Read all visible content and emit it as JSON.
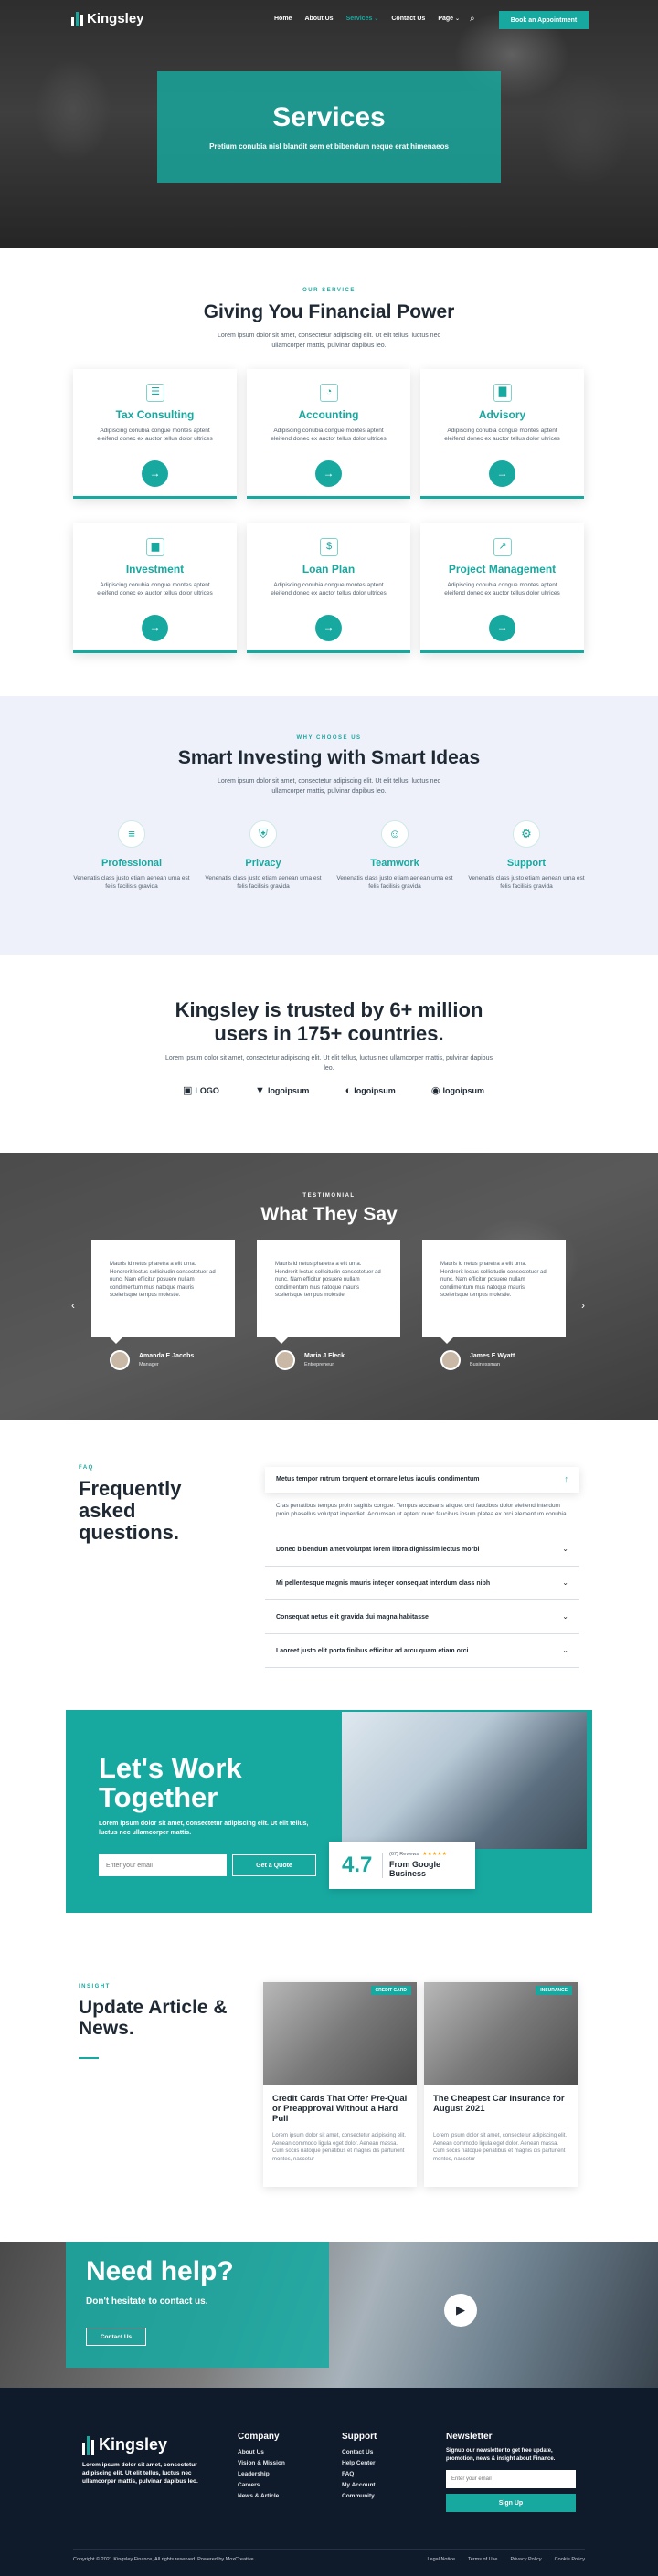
{
  "brand": {
    "name": "Kingsley",
    "accent": "#17a9a0",
    "dark": "#0f1a2b"
  },
  "nav": {
    "items": [
      "Home",
      "About Us",
      "Services",
      "Contact Us",
      "Page"
    ],
    "active": "Services",
    "search_icon": "search-icon",
    "cta": "Book an Appointment"
  },
  "hero": {
    "title": "Services",
    "subtitle": "Pretium conubia nisl blandit sem et bibendum neque erat himenaeos"
  },
  "services": {
    "eyebrow": "OUR SERVICE",
    "title": "Giving You Financial Power",
    "subtitle": "Lorem ipsum dolor sit amet, consectetur adipiscing elit. Ut elit tellus, luctus nec ullamcorper mattis, pulvinar dapibus leo.",
    "cards": [
      {
        "title": "Tax Consulting",
        "desc": "Adipiscing conubia congue montes aptent eleifend donec ex auctor tellus dolor ultrices",
        "icon": "document-icon"
      },
      {
        "title": "Accounting",
        "desc": "Adipiscing conubia congue montes aptent eleifend donec ex auctor tellus dolor ultrices",
        "icon": "pie-chart-icon"
      },
      {
        "title": "Advisory",
        "desc": "Adipiscing conubia congue montes aptent eleifend donec ex auctor tellus dolor ultrices",
        "icon": "bar-chart-icon"
      },
      {
        "title": "Investment",
        "desc": "Adipiscing conubia congue montes aptent eleifend donec ex auctor tellus dolor ultrices",
        "icon": "growth-chart-icon"
      },
      {
        "title": "Loan Plan",
        "desc": "Adipiscing conubia congue montes aptent eleifend donec ex auctor tellus dolor ultrices",
        "icon": "dollar-icon"
      },
      {
        "title": "Project Management",
        "desc": "Adipiscing conubia congue montes aptent eleifend donec ex auctor tellus dolor ultrices",
        "icon": "line-chart-icon"
      }
    ]
  },
  "why": {
    "eyebrow": "WHY CHOOSE US",
    "title": "Smart Investing with Smart Ideas",
    "subtitle": "Lorem ipsum dolor sit amet, consectetur adipiscing elit. Ut elit tellus, luctus nec ullamcorper mattis, pulvinar dapibus leo.",
    "items": [
      {
        "title": "Professional",
        "desc": "Venenatis class justo etiam aenean urna est felis facilisis gravida",
        "icon": "layers-icon"
      },
      {
        "title": "Privacy",
        "desc": "Venenatis class justo etiam aenean urna est felis facilisis gravida",
        "icon": "shield-icon"
      },
      {
        "title": "Teamwork",
        "desc": "Venenatis class justo etiam aenean urna est felis facilisis gravida",
        "icon": "team-icon"
      },
      {
        "title": "Support",
        "desc": "Venenatis class justo etiam aenean urna est felis facilisis gravida",
        "icon": "support-icon"
      }
    ]
  },
  "trust": {
    "title": "Kingsley is trusted by 6+ million users in 175+ countries.",
    "subtitle": "Lorem ipsum dolor sit amet, consectetur adipiscing elit. Ut elit tellus, luctus nec ullamcorper mattis, pulvinar dapibus leo.",
    "logos": [
      "LOGO",
      "logoipsum",
      "logoipsum",
      "logoipsum"
    ]
  },
  "testimonials": {
    "eyebrow": "TESTIMONIAL",
    "title": "What They Say",
    "items": [
      {
        "quote": "Mauris id netus pharetra a elit urna. Hendrerit lectus sollicitudin consectetuer ad nunc. Nam efficitur posuere nullam condimentum mus natoque mauris scelerisque tempus molestie.",
        "name": "Amanda E Jacobs",
        "role": "Manager"
      },
      {
        "quote": "Mauris id netus pharetra a elit urna. Hendrerit lectus sollicitudin consectetuer ad nunc. Nam efficitur posuere nullam condimentum mus natoque mauris scelerisque tempus molestie.",
        "name": "Maria J Fleck",
        "role": "Entrepreneur"
      },
      {
        "quote": "Mauris id netus pharetra a elit urna. Hendrerit lectus sollicitudin consectetuer ad nunc. Nam efficitur posuere nullam condimentum mus natoque mauris scelerisque tempus molestie.",
        "name": "James E Wyatt",
        "role": "Businessman"
      }
    ]
  },
  "faq": {
    "eyebrow": "FAQ",
    "title": "Frequently asked questions.",
    "open": {
      "q": "Metus tempor rutrum torquent et ornare letus iaculis condimentum",
      "a": "Cras penatibus tempus proin sagittis congue. Tempus accusans aliquet orci faucibus dolor eleifend interdum proin phasellus volutpat imperdiet. Accumsan ut aptent nunc faucibus ipsum platea ex orci elementum conubia."
    },
    "items": [
      "Donec bibendum amet volutpat lorem litora dignissim lectus morbi",
      "Mi pellentesque magnis mauris integer consequat interdum class nibh",
      "Consequat netus elit gravida dui magna habitasse",
      "Laoreet justo elit porta finibus efficitur ad arcu quam etiam orci"
    ]
  },
  "cta": {
    "title": "Let's Work Together",
    "subtitle": "Lorem ipsum dolor sit amet, consectetur adipiscing elit. Ut elit tellus, luctus nec ullamcorper mattis.",
    "input_placeholder": "Enter your email",
    "button": "Get a Quote",
    "rating": "4.7",
    "reviews": "(67) Reviews",
    "stars": "★★★★★",
    "rating_label": "From Google Business"
  },
  "insight": {
    "eyebrow": "INSIGHT",
    "title": "Update Article & News.",
    "posts": [
      {
        "tag": "CREDIT CARD",
        "title": "Credit Cards That Offer Pre-Qual or Preapproval Without a Hard Pull",
        "desc": "Lorem ipsum dolor sit amet, consectetur adipiscing elit. Aenean commodo ligula eget dolor. Aenean massa. Cum sociis natoque penatibus et magnis dis parturient montes, nascetur"
      },
      {
        "tag": "INSURANCE",
        "title": "The Cheapest Car Insurance for August 2021",
        "desc": "Lorem ipsum dolor sit amet, consectetur adipiscing elit. Aenean commodo ligula eget dolor. Aenean massa. Cum sociis natoque penatibus et magnis dis parturient montes, nascetur"
      }
    ]
  },
  "help": {
    "title": "Need help?",
    "subtitle": "Don't hesitate to contact us.",
    "button": "Contact Us"
  },
  "footer": {
    "about": "Lorem ipsum dolor sit amet, consectetur adipiscing elit. Ut elit tellus, luctus nec ullamcorper mattis, pulvinar dapibus leo.",
    "company": {
      "title": "Company",
      "links": [
        "About Us",
        "Vision & Mission",
        "Leadership",
        "Careers",
        "News & Article"
      ]
    },
    "support": {
      "title": "Support",
      "links": [
        "Contact Us",
        "Help Center",
        "FAQ",
        "My Account",
        "Community"
      ]
    },
    "newsletter": {
      "title": "Newsletter",
      "text": "Signup our newsletter to get free update, promotion, news & insight about Finance.",
      "placeholder": "Enter your email",
      "button": "Sign Up"
    },
    "copyright": "Copyright © 2021 Kingsley Finance, All rights reserved. Powered by MoxCreative.",
    "legal": [
      "Legal Notice",
      "Terms of Use",
      "Privacy Policy",
      "Cookie Policy"
    ]
  }
}
